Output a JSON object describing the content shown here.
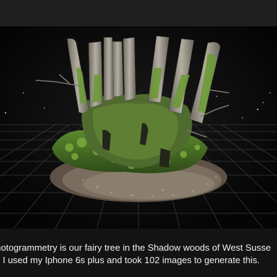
{
  "caption": {
    "line1": "hotogrammetry is our fairy tree in the Shadow woods of West Susse",
    "line2": "I used my Iphone 6s plus and took 102 images to generate this."
  },
  "colors": {
    "background": "#0e0e0e",
    "top_band": "#1f1f1f",
    "viewport": "#080808",
    "grid": "#3a3a3a",
    "caption_text": "#f2f2f2",
    "moss": "#4d7a2a",
    "bark": "#8e8a7e"
  },
  "scene": {
    "icon": "tree-3d-model-icon",
    "grid_icon": "ground-grid-icon"
  }
}
